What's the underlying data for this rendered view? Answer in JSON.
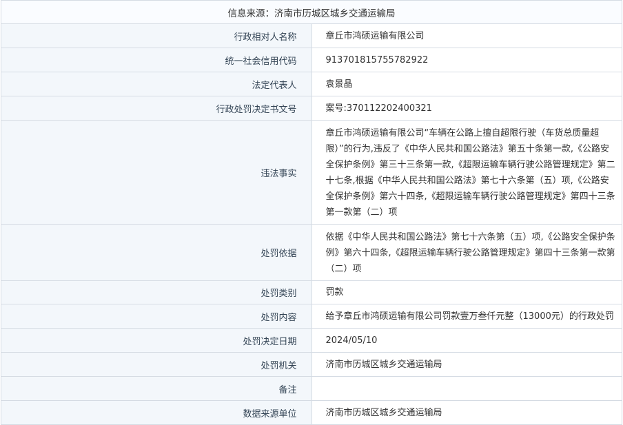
{
  "header": {
    "source": "信息来源：济南市历城区城乡交通运输局"
  },
  "rows": [
    {
      "label": "行政相对人名称",
      "value": "章丘市鸿硕运输有限公司"
    },
    {
      "label": "统一社会信用代码",
      "value": "913701815755782922"
    },
    {
      "label": "法定代表人",
      "value": "袁景晶"
    },
    {
      "label": "行政处罚决定书文号",
      "value": "案号:370112202400321"
    },
    {
      "label": "违法事实",
      "value": "章丘市鸿硕运输有限公司“车辆在公路上擅自超限行驶（车货总质量超限）”的行为,违反了《中华人民共和国公路法》第五十条第一款,《公路安全保护条例》第三十三条第一款,《超限运输车辆行驶公路管理规定》第二十七条,根据《中华人民共和国公路法》第七十六条第（五）项,《公路安全保护条例》第六十四条,《超限运输车辆行驶公路管理规定》第四十三条第一款第（二）项"
    },
    {
      "label": "处罚依据",
      "value": "依据《中华人民共和国公路法》第七十六条第（五）项,《公路安全保护条例》第六十四条,《超限运输车辆行驶公路管理规定》第四十三条第一款第（二）项"
    },
    {
      "label": "处罚类别",
      "value": "罚款"
    },
    {
      "label": "处罚内容",
      "value": "给予章丘市鸿硕运输有限公司罚款壹万叁仟元整（13000元）的行政处罚"
    },
    {
      "label": "处罚决定日期",
      "value": "2024/05/10"
    },
    {
      "label": "处罚机关",
      "value": "济南市历城区城乡交通运输局"
    },
    {
      "label": "备注",
      "value": ""
    },
    {
      "label": "数据来源单位",
      "value": "济南市历城区城乡交通运输局"
    }
  ]
}
